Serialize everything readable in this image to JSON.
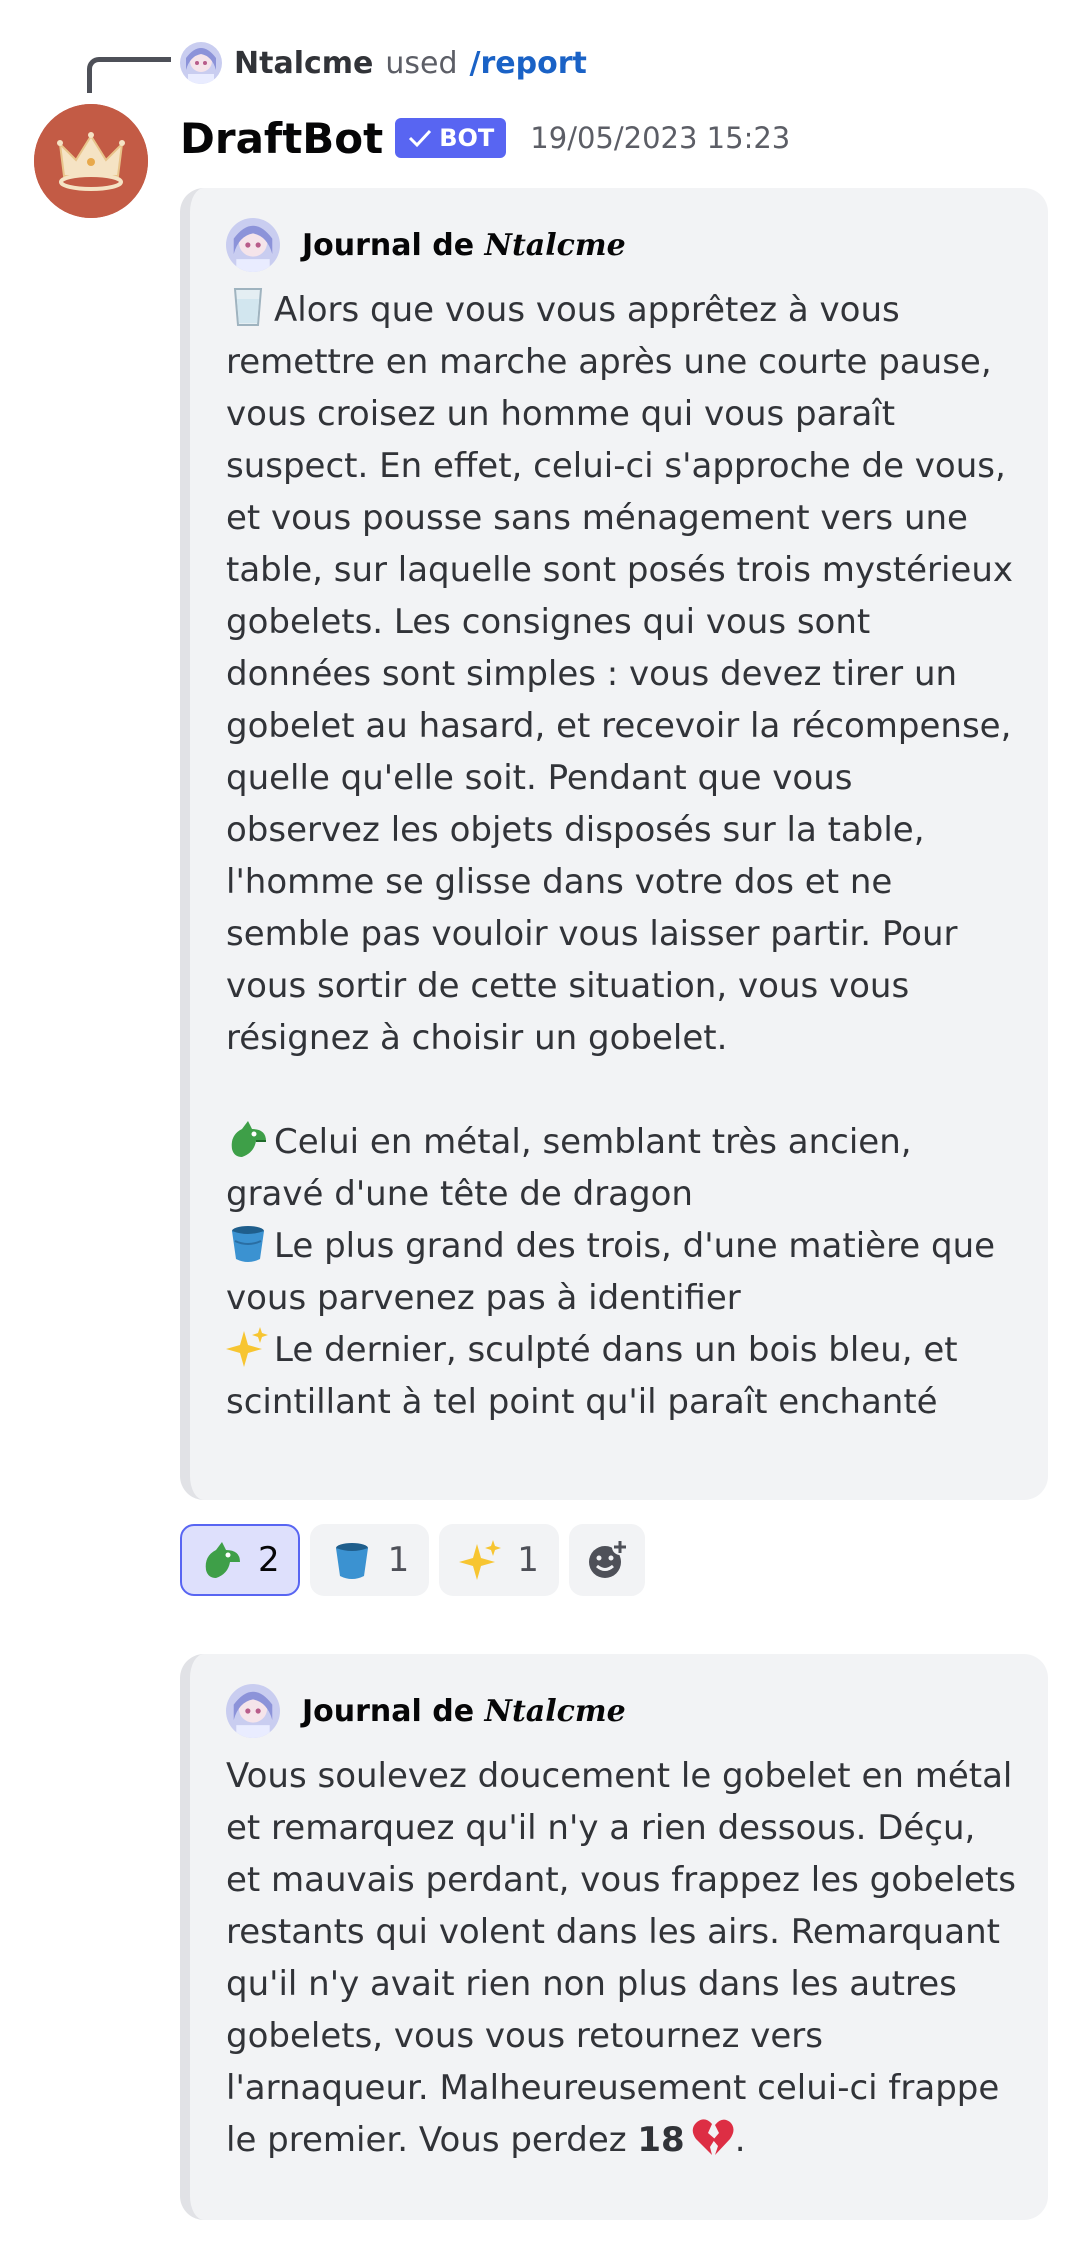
{
  "reply": {
    "username": "Ntalcme",
    "used_text": "used",
    "command": "/report"
  },
  "message": {
    "author": "DraftBot",
    "bot_tag": "BOT",
    "timestamp": "19/05/2023 15:23"
  },
  "embed1": {
    "author_prefix": "Journal de ",
    "author_name": "Ntalcme",
    "intro_emoji": "cup-icon",
    "intro": "Alors que vous vous apprêtez à vous remettre en marche après une courte pause, vous croisez un homme qui vous paraît suspect. En effet, celui-ci s'approche de vous, et vous pousse sans ménagement vers une table, sur laquelle sont posés trois mystérieux gobelets. Les consignes qui vous sont données sont simples : vous devez tirer un gobelet au hasard, et recevoir la récompense, quelle qu'elle soit. Pendant que vous observez les objets disposés sur la table, l'homme se glisse dans votre dos et ne semble pas vouloir vous laisser partir. Pour vous sortir de cette situation, vous vous résignez à choisir un gobelet.",
    "options": [
      {
        "icon": "dragon-icon",
        "text": "Celui en métal, semblant très ancien, gravé d'une tête de dragon"
      },
      {
        "icon": "bucket-icon",
        "text": "Le plus grand des trois, d'une matière que vous parvenez pas à identifier"
      },
      {
        "icon": "sparkles-icon",
        "text": "Le dernier, sculpté dans un bois bleu, et scintillant à tel point qu'il paraît enchanté"
      }
    ]
  },
  "reactions": [
    {
      "icon": "dragon-icon",
      "count": "2",
      "selected": true
    },
    {
      "icon": "bucket-icon",
      "count": "1",
      "selected": false
    },
    {
      "icon": "sparkles-icon",
      "count": "1",
      "selected": false
    },
    {
      "icon": "add-reaction-icon",
      "count": "",
      "selected": false
    }
  ],
  "embed2": {
    "author_prefix": "Journal de ",
    "author_name": "Ntalcme",
    "text": "Vous soulevez doucement le gobelet en métal et remarquez qu'il n'y a rien dessous. Déçu, et mauvais perdant, vous frappez les gobelets restants qui volent dans les airs. Remarquant qu'il n'y avait rien non plus dans les autres gobelets, vous vous retournez vers l'arnaqueur. Malheureusement celui-ci frappe le premier. Vous perdez ",
    "amount": "18",
    "amount_icon": "broken-heart-icon",
    "end": "."
  },
  "colors": {
    "blurple": "#5865f2",
    "embed_bg": "#f2f3f5",
    "embed_border": "#e1e2e6",
    "link": "#1a62c6",
    "avatar_bg": "#c35b45"
  }
}
